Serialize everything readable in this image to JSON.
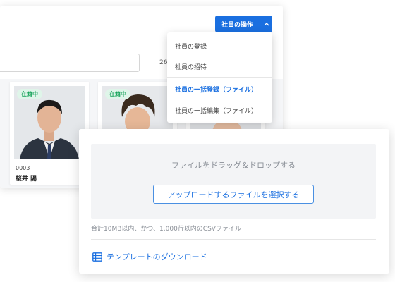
{
  "toolbar": {
    "ops_label": "社員の操作"
  },
  "list": {
    "count": "26",
    "cards": [
      {
        "status": "在籍中",
        "id": "0003",
        "name": "桜井 陽"
      },
      {
        "status": "在籍中"
      }
    ]
  },
  "dropdown": {
    "items": [
      "社員の登録",
      "社員の招待",
      "社員の一括登録（ファイル）",
      "社員の一括編集（ファイル）"
    ]
  },
  "upload": {
    "drop_text": "ファイルをドラッグ＆ドロップする",
    "select_label": "アップロードするファイルを選択する",
    "limit_text": "合計10MB以内、かつ、1,000行以内のCSVファイル",
    "template_link": "テンプレートのダウンロード"
  },
  "colors": {
    "accent": "#1a6fe0",
    "badge_bg": "#dff5e9",
    "badge_text": "#17a35a"
  }
}
